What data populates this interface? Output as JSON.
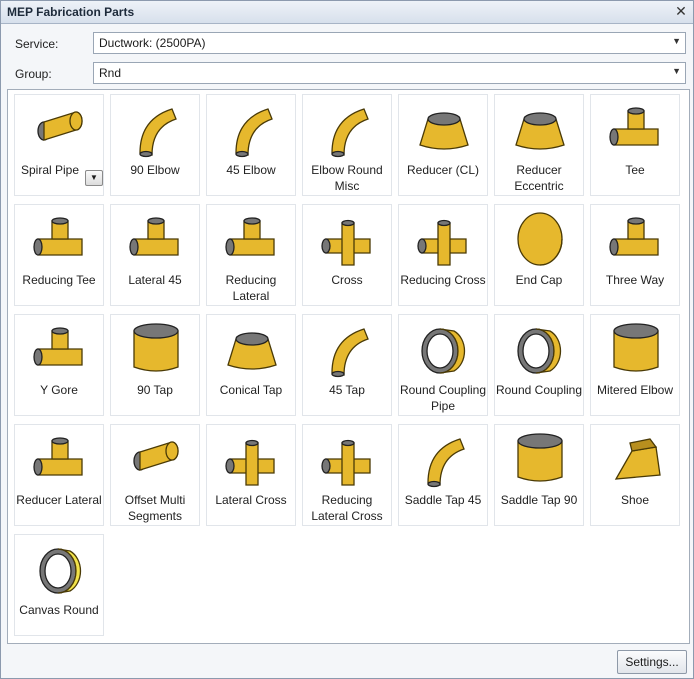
{
  "window": {
    "title": "MEP Fabrication Parts",
    "close_icon": "close-icon"
  },
  "service": {
    "label": "Service:",
    "value": "Ductwork: (2500PA)"
  },
  "group": {
    "label": "Group:",
    "value": "Rnd"
  },
  "parts": [
    {
      "label": "Spiral Pipe",
      "icon": "spiral-pipe-icon",
      "dropdown": true
    },
    {
      "label": "90 Elbow",
      "icon": "elbow-90-icon"
    },
    {
      "label": "45 Elbow",
      "icon": "elbow-45-icon"
    },
    {
      "label": "Elbow Round Misc",
      "icon": "elbow-round-misc-icon"
    },
    {
      "label": "Reducer (CL)",
      "icon": "reducer-cl-icon"
    },
    {
      "label": "Reducer Eccentric",
      "icon": "reducer-eccentric-icon"
    },
    {
      "label": "Tee",
      "icon": "tee-icon"
    },
    {
      "label": "Reducing Tee",
      "icon": "reducing-tee-icon"
    },
    {
      "label": "Lateral 45",
      "icon": "lateral-45-icon"
    },
    {
      "label": "Reducing Lateral",
      "icon": "reducing-lateral-icon"
    },
    {
      "label": "Cross",
      "icon": "cross-icon"
    },
    {
      "label": "Reducing Cross",
      "icon": "reducing-cross-icon"
    },
    {
      "label": "End Cap",
      "icon": "end-cap-icon"
    },
    {
      "label": "Three Way",
      "icon": "three-way-icon"
    },
    {
      "label": "Y Gore",
      "icon": "y-gore-icon"
    },
    {
      "label": "90 Tap",
      "icon": "tap-90-icon"
    },
    {
      "label": "Conical Tap",
      "icon": "conical-tap-icon"
    },
    {
      "label": "45 Tap",
      "icon": "tap-45-icon"
    },
    {
      "label": "Round Coupling Pipe",
      "icon": "round-coupling-pipe-icon"
    },
    {
      "label": "Round Coupling",
      "icon": "round-coupling-icon"
    },
    {
      "label": "Mitered Elbow",
      "icon": "mitered-elbow-icon"
    },
    {
      "label": "Reducer Lateral",
      "icon": "reducer-lateral-icon"
    },
    {
      "label": "Offset Multi Segments",
      "icon": "offset-multi-segments-icon"
    },
    {
      "label": "Lateral Cross",
      "icon": "lateral-cross-icon"
    },
    {
      "label": "Reducing Lateral Cross",
      "icon": "reducing-lateral-cross-icon"
    },
    {
      "label": "Saddle Tap 45",
      "icon": "saddle-tap-45-icon"
    },
    {
      "label": "Saddle Tap 90",
      "icon": "saddle-tap-90-icon"
    },
    {
      "label": "Shoe",
      "icon": "shoe-icon"
    },
    {
      "label": "Canvas Round",
      "icon": "canvas-round-icon"
    }
  ],
  "settings_button": "Settings...",
  "colors": {
    "part_fill": "#e6b82d",
    "part_opening": "#777777"
  }
}
